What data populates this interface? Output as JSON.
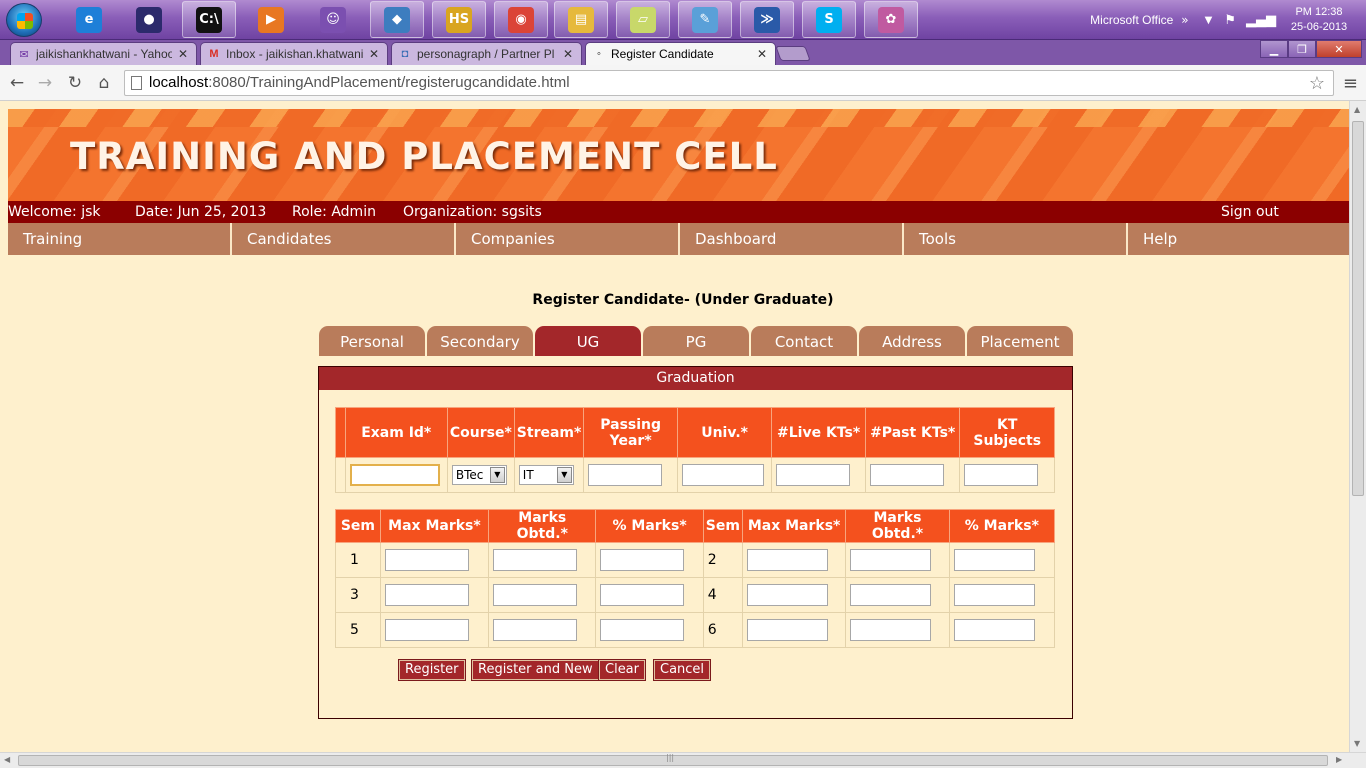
{
  "taskbar": {
    "pinned": [
      {
        "name": "ie",
        "glyph": "e",
        "color": "#1e7fd8"
      },
      {
        "name": "eclipse",
        "glyph": "●",
        "color": "#2c2a6c"
      },
      {
        "name": "cmd",
        "glyph": "C:\\",
        "color": "#111111"
      },
      {
        "name": "media-player",
        "glyph": "▶",
        "color": "#e87722"
      },
      {
        "name": "messenger",
        "glyph": "☺",
        "color": "#7b4fb0"
      },
      {
        "name": "virtualbox",
        "glyph": "◆",
        "color": "#3d7dbf"
      },
      {
        "name": "hs",
        "glyph": "HS",
        "color": "#d9a520"
      },
      {
        "name": "chrome",
        "glyph": "◉",
        "color": "#db4437"
      },
      {
        "name": "explorer",
        "glyph": "▤",
        "color": "#e6b93c"
      },
      {
        "name": "sticky-notes",
        "glyph": "▱",
        "color": "#c8d86a"
      },
      {
        "name": "editor",
        "glyph": "✎",
        "color": "#5aa0d8"
      },
      {
        "name": "powershell",
        "glyph": "≫",
        "color": "#2a5aa8"
      },
      {
        "name": "skype",
        "glyph": "S",
        "color": "#00aff0"
      },
      {
        "name": "paint",
        "glyph": "✿",
        "color": "#c05aa0"
      }
    ],
    "tray_app": "Microsoft Office",
    "tray_chevron": "»",
    "clock_time": "PM 12:38",
    "clock_date": "25-06-2013"
  },
  "browser": {
    "tabs": [
      {
        "title": "jaikishankhatwani - Yahoo",
        "favicon": "✉",
        "close": "✕"
      },
      {
        "title": "Inbox - jaikishan.khatwani",
        "favicon": "M",
        "close": "✕"
      },
      {
        "title": "personagraph / Partner Pl",
        "favicon": "◘",
        "close": "✕"
      },
      {
        "title": "Register Candidate",
        "favicon": "◦",
        "close": "✕"
      }
    ],
    "url_host": "localhost",
    "url_rest": ":8080/TrainingAndPlacement/registerugcandidate.html"
  },
  "site": {
    "banner_title": "TRAINING AND PLACEMENT CELL",
    "welcome": "Welcome: jsk",
    "date": "Date: Jun 25, 2013",
    "role": "Role: Admin",
    "organization": "Organization: sgsits",
    "sign_out": "Sign out",
    "nav": [
      "Training",
      "Candidates",
      "Companies",
      "Dashboard",
      "Tools",
      "Help"
    ]
  },
  "form": {
    "title": "Register Candidate- (Under Graduate)",
    "tabs": [
      "Personal",
      "Secondary",
      "UG",
      "PG",
      "Contact",
      "Address",
      "Placement"
    ],
    "active_tab": "UG",
    "panel_title": "Graduation",
    "grad_headers": [
      "Exam Id*",
      "Course*",
      "Stream*",
      "Passing Year*",
      "Univ.*",
      "#Live KTs*",
      "#Past KTs*",
      "KT Subjects"
    ],
    "course_value": "BTec",
    "stream_value": "IT",
    "sem_headers": [
      "Sem",
      "Max Marks*",
      "Marks Obtd.*",
      "% Marks*",
      "Sem",
      "Max Marks*",
      "Marks Obtd.*",
      "% Marks*"
    ],
    "sem_rows": [
      [
        "1",
        "2"
      ],
      [
        "3",
        "4"
      ],
      [
        "5",
        "6"
      ]
    ],
    "buttons": [
      "Register",
      "Register and New",
      "Clear",
      "Cancel"
    ]
  },
  "colors": {
    "header_red": "#8b0000",
    "nav_brown": "#b97c5b",
    "active_tab": "#a3272a",
    "table_header": "#f4511e",
    "page_bg": "#fef0cd"
  }
}
